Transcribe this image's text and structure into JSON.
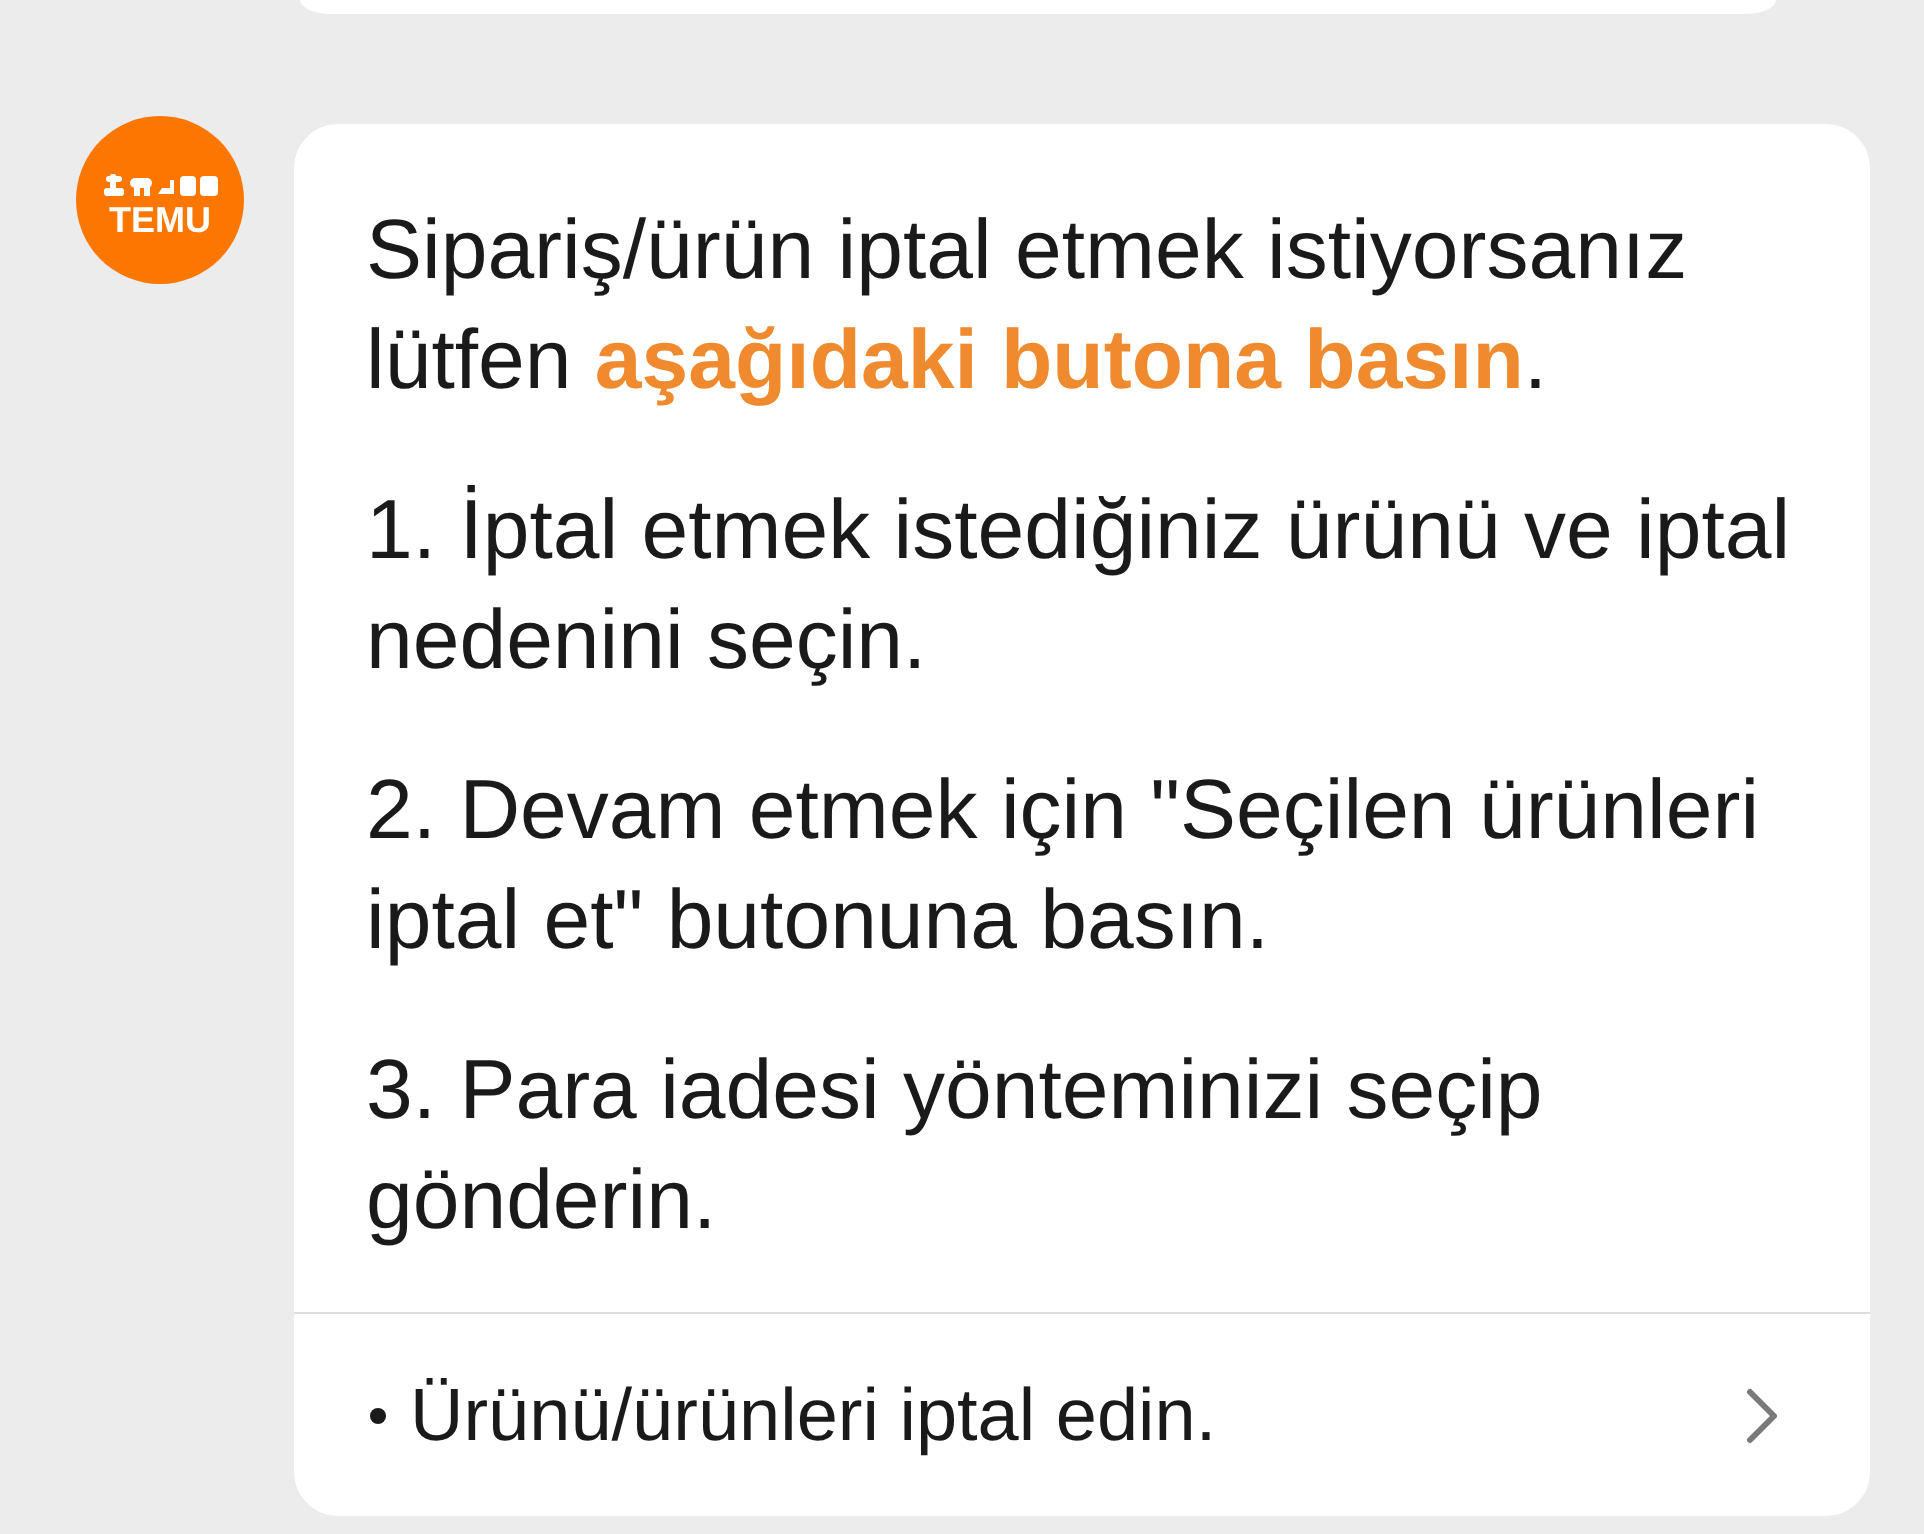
{
  "message": {
    "sender_logo": "TEMU",
    "intro": "Sipariş/ürün iptal etmek istiyorsanız lütfen **aşağıdaki butona basın**.",
    "steps": [
      "1. İptal etmek istediğiniz ürünü ve iptal nedenini seçin.",
      "2. Devam etmek için \"Seçilen ürünleri iptal et\" butonuna basın.",
      "3. Para iadesi yönteminizi seçip gönderin."
    ],
    "actions": [
      {
        "label": "Ürünü/ürünleri iptal edin."
      }
    ]
  }
}
